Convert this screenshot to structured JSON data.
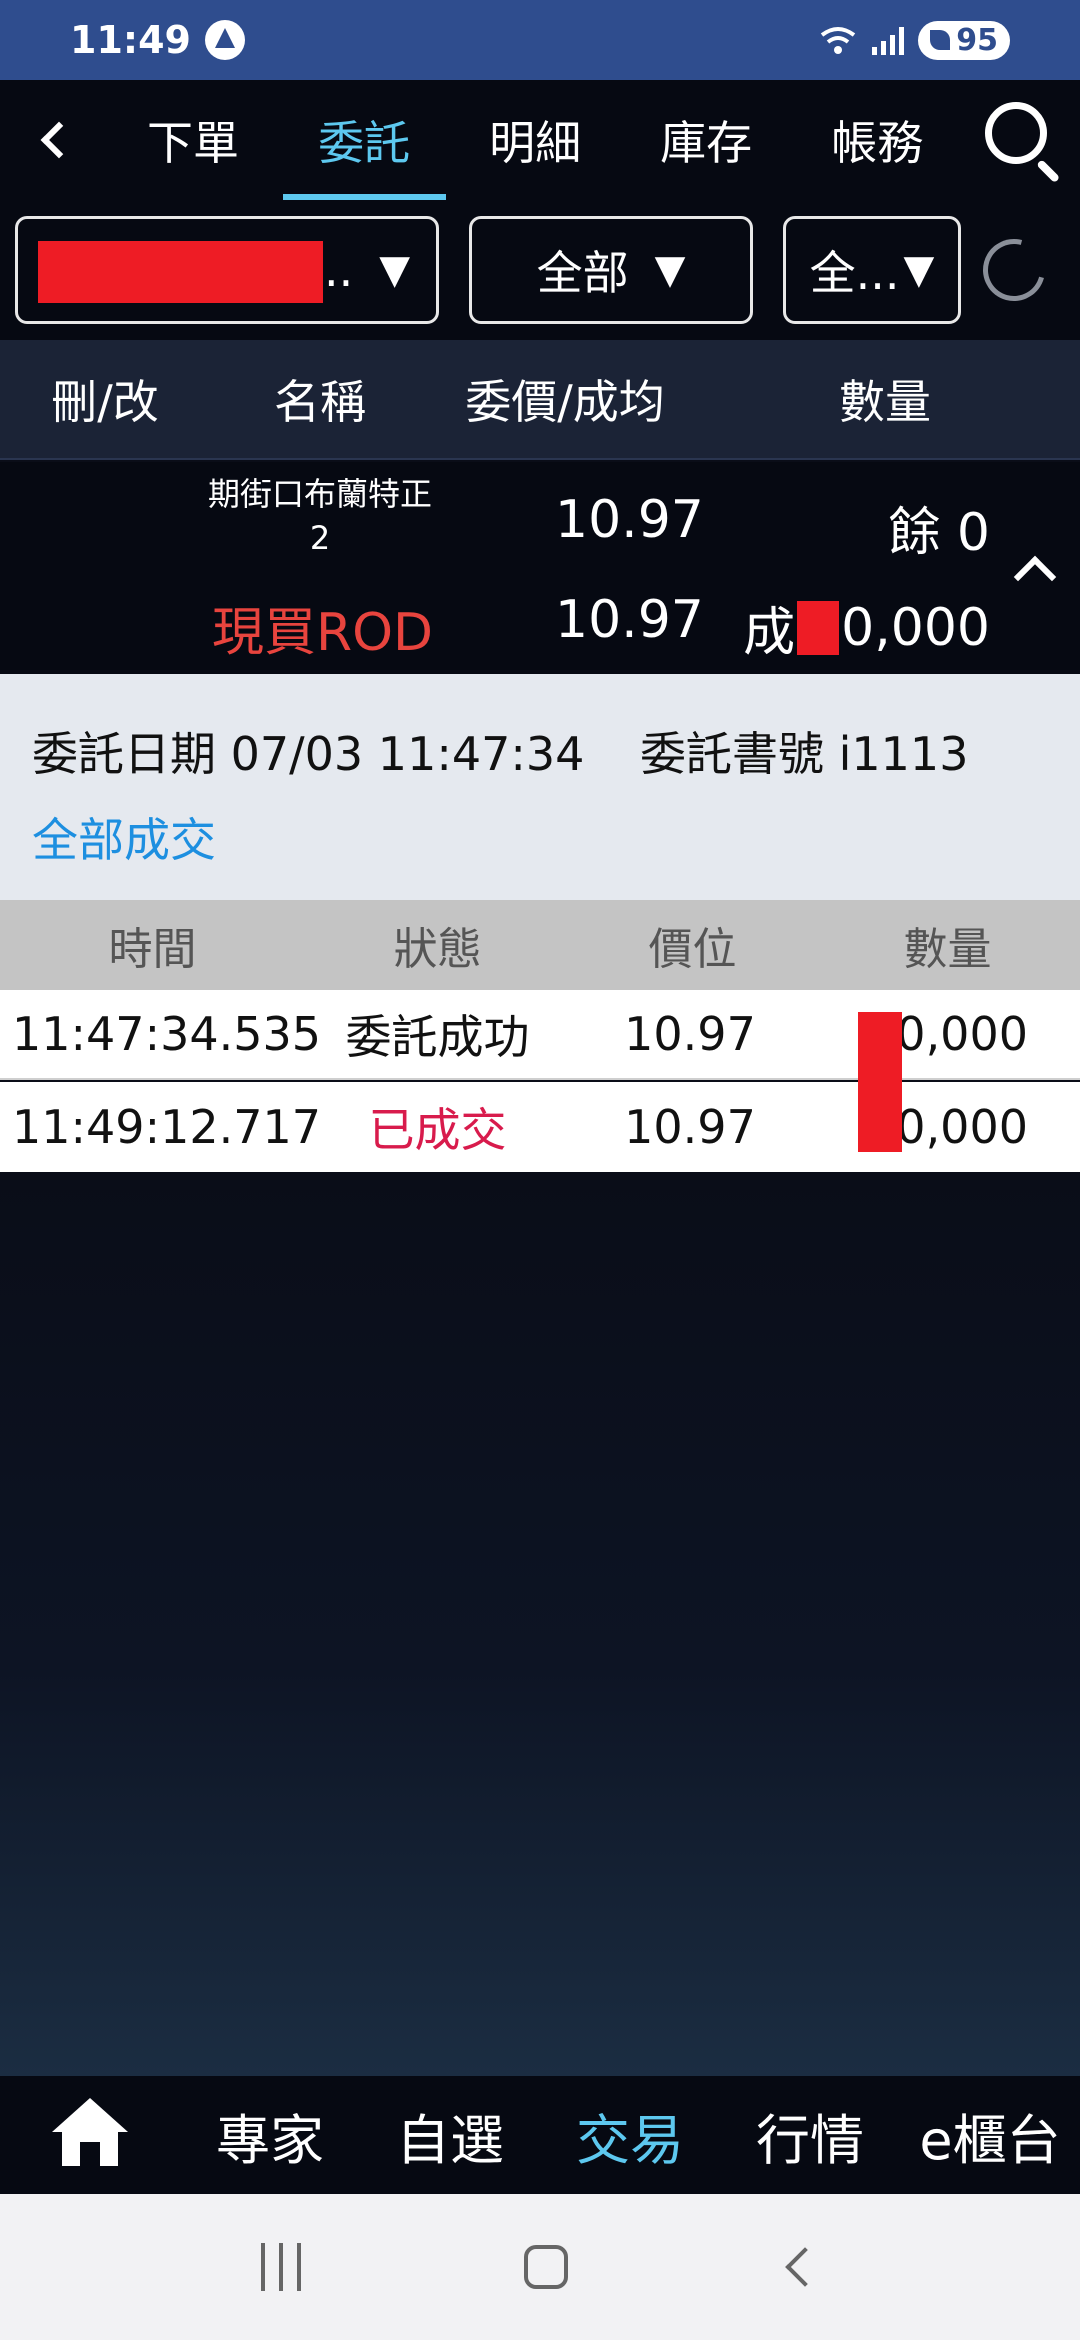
{
  "status_bar": {
    "time": "11:49",
    "battery": "95"
  },
  "top_tabs": [
    {
      "label": "下單",
      "active": false
    },
    {
      "label": "委託",
      "active": true
    },
    {
      "label": "明細",
      "active": false
    },
    {
      "label": "庫存",
      "active": false
    },
    {
      "label": "帳務",
      "active": false
    }
  ],
  "filters": {
    "account_suffix": "3...",
    "type": "全部",
    "market": "全..."
  },
  "columns": {
    "action": "刪/改",
    "name": "名稱",
    "price": "委價/成均",
    "qty": "數量"
  },
  "order": {
    "name_line1": "期街口布蘭特正",
    "name_line2": "2",
    "order_price": "10.97",
    "remaining": "餘 0",
    "type": "現買ROD",
    "avg_price": "10.97",
    "filled_prefix": "成",
    "filled_suffix": "0,000"
  },
  "detail": {
    "date": "委託日期 07/03 11:47:34",
    "order_no": "委託書號 i1113",
    "status": "全部成交"
  },
  "fills": {
    "headers": {
      "time": "時間",
      "status": "狀態",
      "price": "價位",
      "qty": "數量"
    },
    "rows": [
      {
        "time": "11:47:34.535",
        "status": "委託成功",
        "price": "10.97",
        "qty": "0,000"
      },
      {
        "time": "11:49:12.717",
        "status": "已成交",
        "price": "10.97",
        "qty": "0,000"
      }
    ]
  },
  "bottom_nav": [
    {
      "label": "專家",
      "active": false
    },
    {
      "label": "自選",
      "active": false
    },
    {
      "label": "交易",
      "active": true
    },
    {
      "label": "行情",
      "active": false
    },
    {
      "label": "e櫃台",
      "active": false
    }
  ],
  "colors": {
    "accent": "#5dc8ef",
    "buy_red": "#e8443e",
    "link_blue": "#1d8fe0",
    "redaction": "#ee1c25"
  }
}
